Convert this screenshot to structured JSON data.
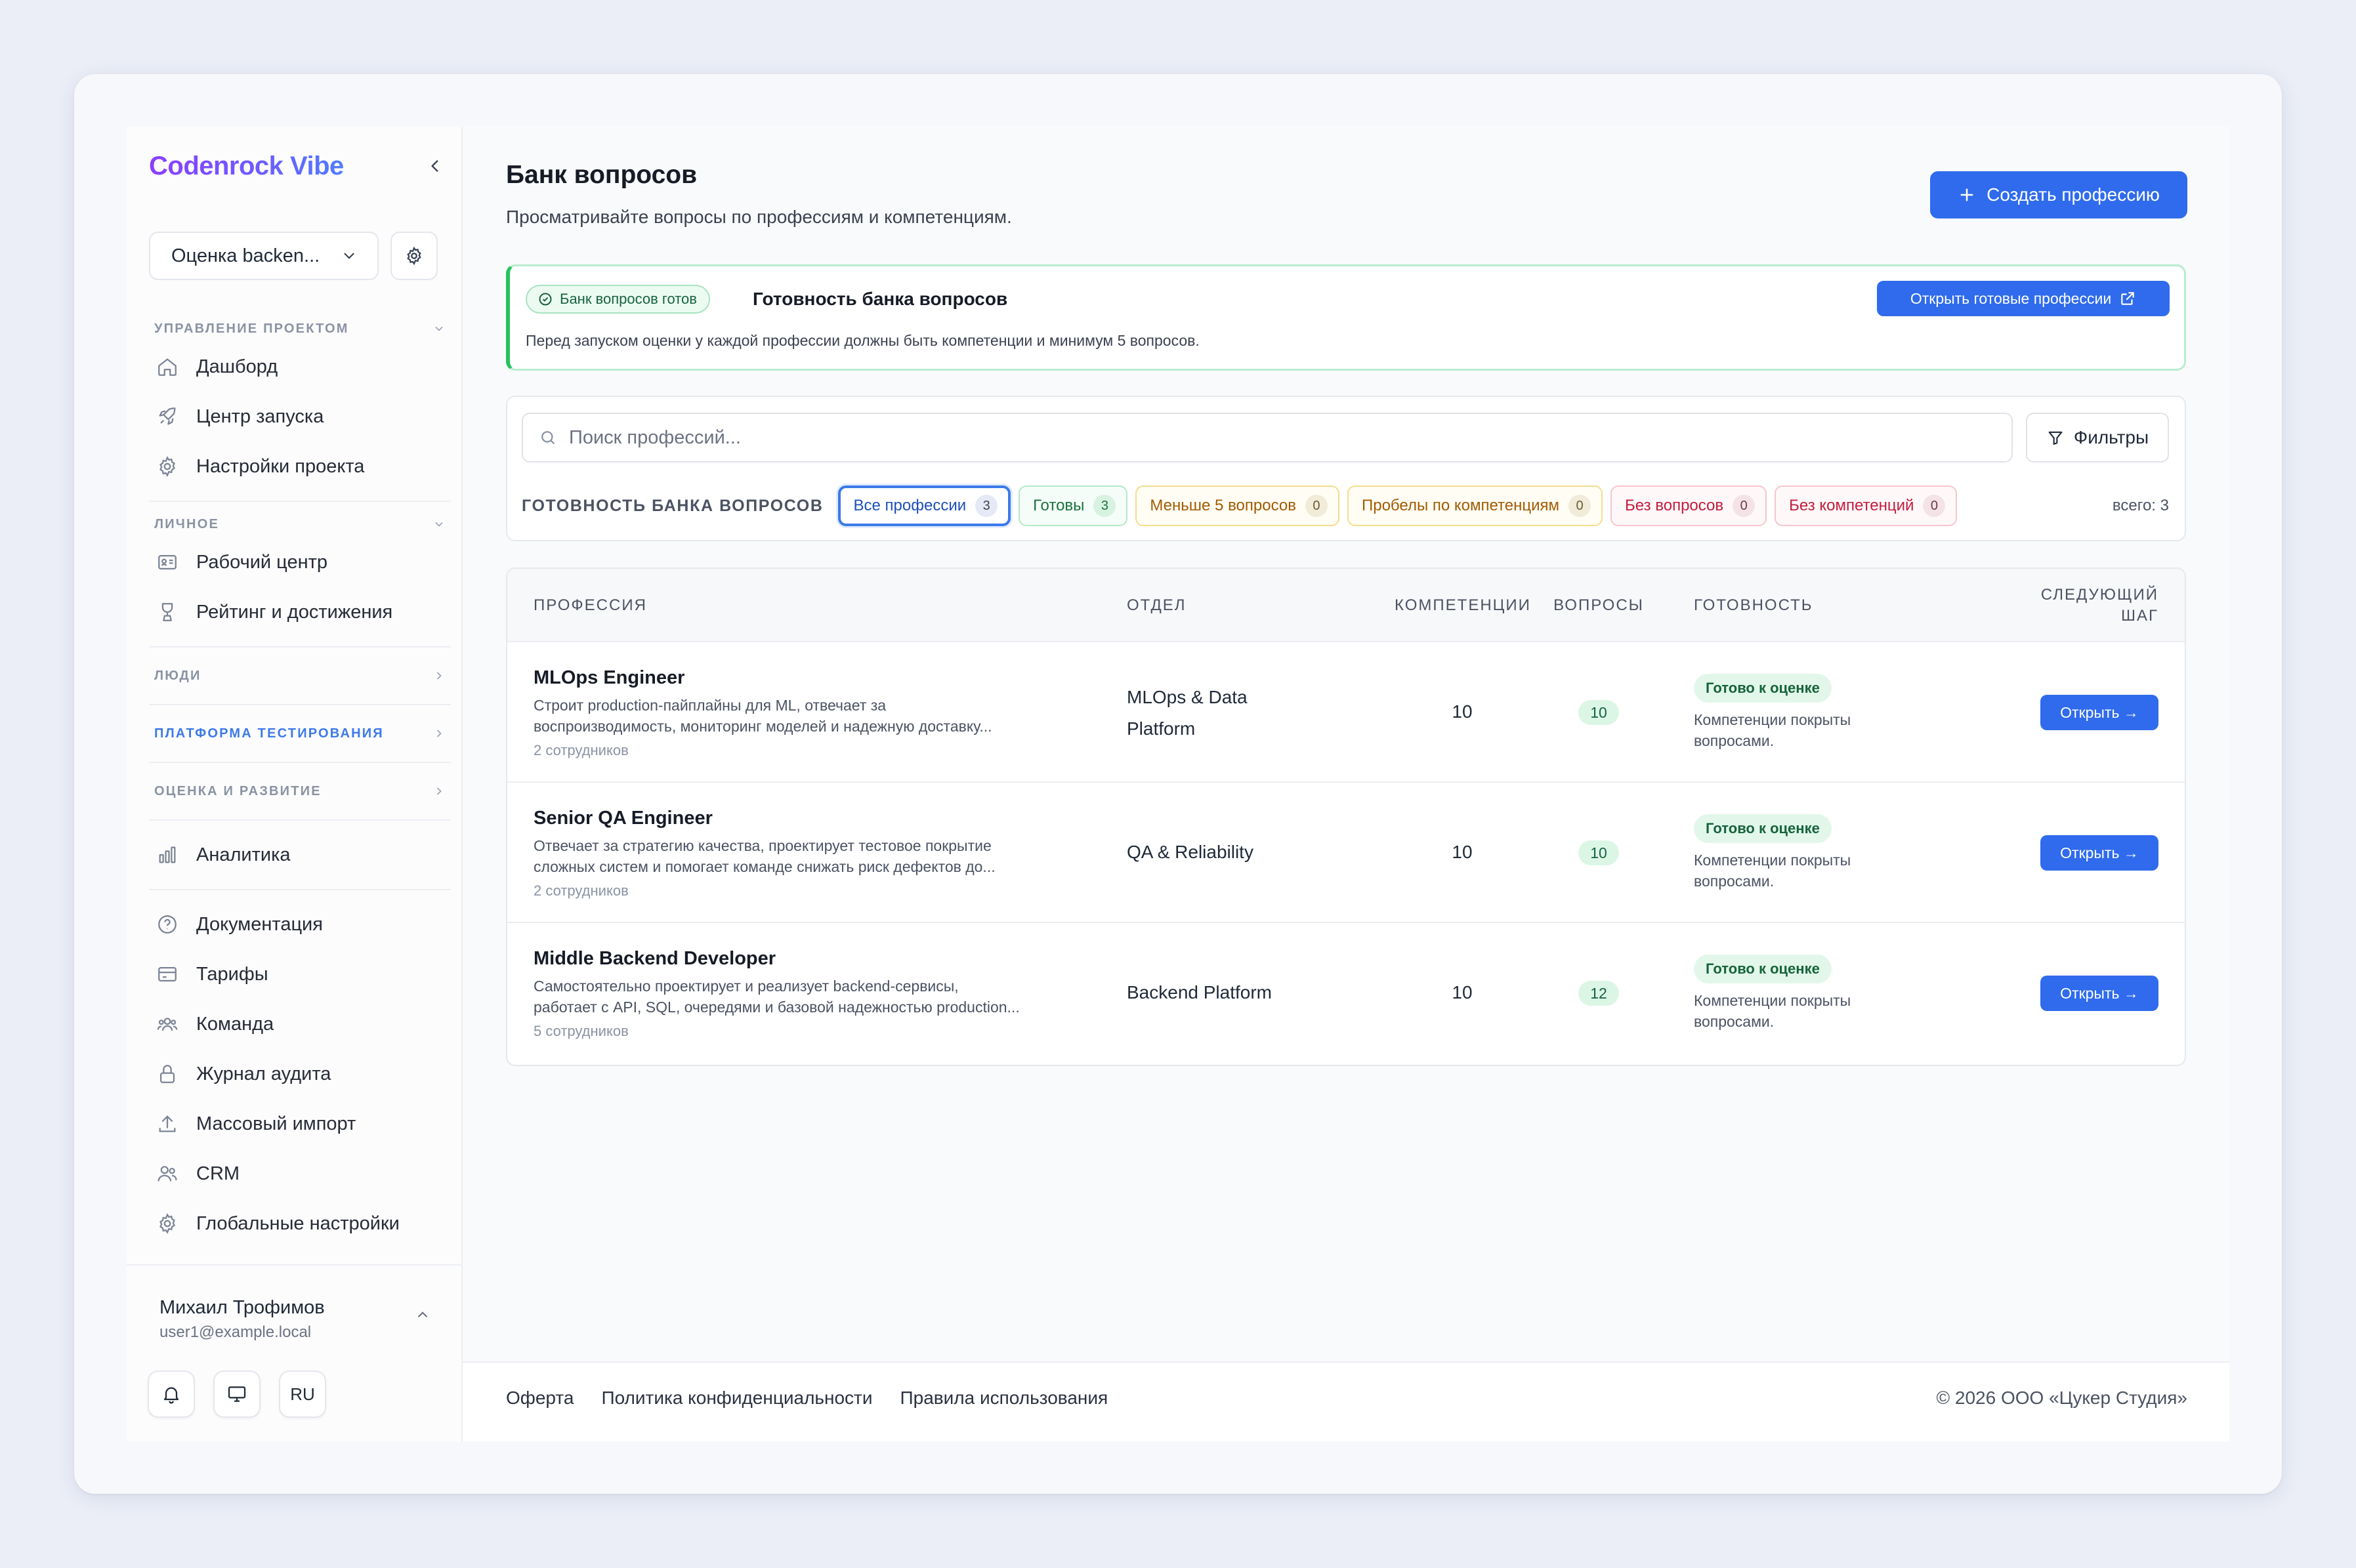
{
  "sidebar": {
    "brand": "Codenrock Vibe",
    "project_select": "Оценка backen...",
    "sections": {
      "project_mgmt": "Управление проектом",
      "personal": "Личное",
      "people": "Люди",
      "testing": "Платформа тестирования",
      "evaluation": "Оценка и развитие"
    },
    "items": {
      "dashboard": "Дашборд",
      "launch": "Центр запуска",
      "project_settings": "Настройки проекта",
      "workspace": "Рабочий центр",
      "rating": "Рейтинг и достижения",
      "analytics": "Аналитика",
      "docs": "Документация",
      "tariffs": "Тарифы",
      "team": "Команда",
      "audit": "Журнал аудита",
      "import": "Массовый импорт",
      "crm": "CRM",
      "global_settings": "Глобальные настройки"
    },
    "user": {
      "name": "Михаил Трофимов",
      "email": "user1@example.local",
      "lang": "RU"
    }
  },
  "header": {
    "title": "Банк вопросов",
    "subtitle": "Просматривайте вопросы по профессиям и компетенциям.",
    "create_button": "Создать профессию"
  },
  "readiness": {
    "badge": "Банк вопросов готов",
    "title": "Готовность банка вопросов",
    "description": "Перед запуском оценки у каждой профессии должны быть компетенции и минимум 5 вопросов.",
    "open_button": "Открыть готовые профессии"
  },
  "filters": {
    "search_placeholder": "Поиск профессий...",
    "filters_button": "Фильтры",
    "chips_label": "Готовность банка вопросов",
    "chips": {
      "all": {
        "label": "Все профессии",
        "count": "3"
      },
      "ready": {
        "label": "Готовы",
        "count": "3"
      },
      "less": {
        "label": "Меньше 5 вопросов",
        "count": "0"
      },
      "gaps": {
        "label": "Пробелы по компетенциям",
        "count": "0"
      },
      "noq": {
        "label": "Без вопросов",
        "count": "0"
      },
      "noc": {
        "label": "Без компетенций",
        "count": "0"
      }
    },
    "total": "всего: 3"
  },
  "table": {
    "columns": {
      "profession": "Профессия",
      "department": "Отдел",
      "competencies": "Компетенции",
      "questions": "Вопросы",
      "readiness": "Готовность",
      "next_step_1": "Следующий",
      "next_step_2": "шаг"
    },
    "rows": [
      {
        "name": "MLOps Engineer",
        "desc1": "Строит production-пайплайны для ML, отвечает за",
        "desc2": "воспроизводимость, мониторинг моделей и надежную доставку...",
        "employees": "2 сотрудников",
        "dept1": "MLOps & Data",
        "dept2": "Platform",
        "competencies": "10",
        "questions": "10",
        "status": "Готово к оценке",
        "status_desc1": "Компетенции покрыты",
        "status_desc2": "вопросами.",
        "action": "Открыть →"
      },
      {
        "name": "Senior QA Engineer",
        "desc1": "Отвечает за стратегию качества, проектирует тестовое покрытие",
        "desc2": "сложных систем и помогает команде снижать риск дефектов до...",
        "employees": "2 сотрудников",
        "dept1": "QA & Reliability",
        "competencies": "10",
        "questions": "10",
        "status": "Готово к оценке",
        "status_desc1": "Компетенции покрыты",
        "status_desc2": "вопросами.",
        "action": "Открыть →"
      },
      {
        "name": "Middle Backend Developer",
        "desc1": "Самостоятельно проектирует и реализует backend-сервисы,",
        "desc2": "работает с API, SQL, очередями и базовой надежностью production...",
        "employees": "5 сотрудников",
        "dept1": "Backend Platform",
        "competencies": "10",
        "questions": "12",
        "status": "Готово к оценке",
        "status_desc1": "Компетенции покрыты",
        "status_desc2": "вопросами.",
        "action": "Открыть →"
      }
    ]
  },
  "footer": {
    "offer": "Оферта",
    "privacy": "Политика конфиденциальности",
    "terms": "Правила использования",
    "copyright": "© 2026 ООО «Цукер Студия»"
  },
  "colors": {
    "accent": "#2f6bec",
    "success": "#22c55e",
    "brand_gradient_start": "#8b3dff"
  }
}
